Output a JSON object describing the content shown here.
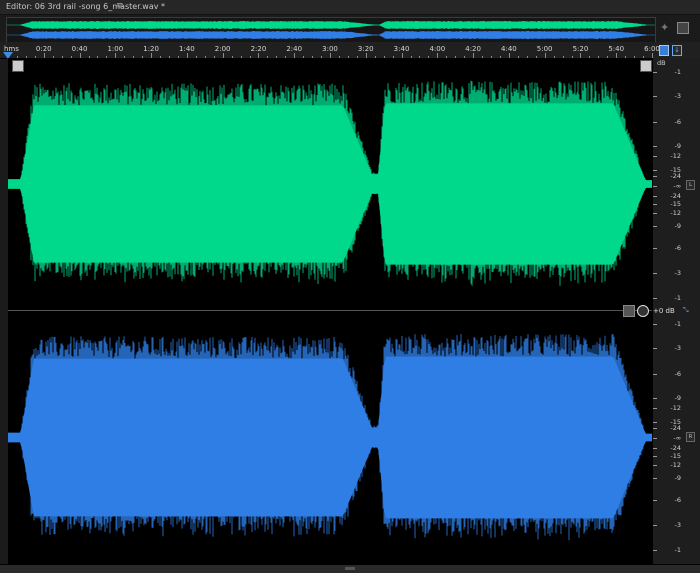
{
  "editor": {
    "title": "Editor: 06 3rd rail -song 6_master.wav *",
    "panel_menu_icon": "panel-menu-icon"
  },
  "ruler": {
    "unit": "hms",
    "labels": [
      "0:20",
      "0:40",
      "1:00",
      "1:20",
      "1:40",
      "2:00",
      "2:20",
      "2:40",
      "3:00",
      "3:20",
      "3:40",
      "4:00",
      "4:20",
      "4:40",
      "5:00",
      "5:20",
      "5:40",
      "6:00"
    ]
  },
  "colors": {
    "left_channel": "#00d98c",
    "right_channel": "#2f7fe6",
    "background": "#000000",
    "playhead": "#3d8ce0"
  },
  "scale": {
    "unit": "dB",
    "top_labels": [
      "-1",
      "-3",
      "-6",
      "-9",
      "-12",
      "-15",
      "-24",
      "-∞",
      "-24",
      "-15",
      "-12",
      "-9",
      "-6",
      "-3",
      "-1"
    ],
    "bottom_labels": [
      "-1",
      "-3",
      "-6",
      "-9",
      "-12",
      "-15",
      "-24",
      "-∞",
      "-24",
      "-15",
      "-12",
      "-9",
      "-6",
      "-3",
      "-1"
    ],
    "left_channel_tag": "L",
    "right_channel_tag": "R"
  },
  "hud": {
    "volume": "+0 dB"
  }
}
